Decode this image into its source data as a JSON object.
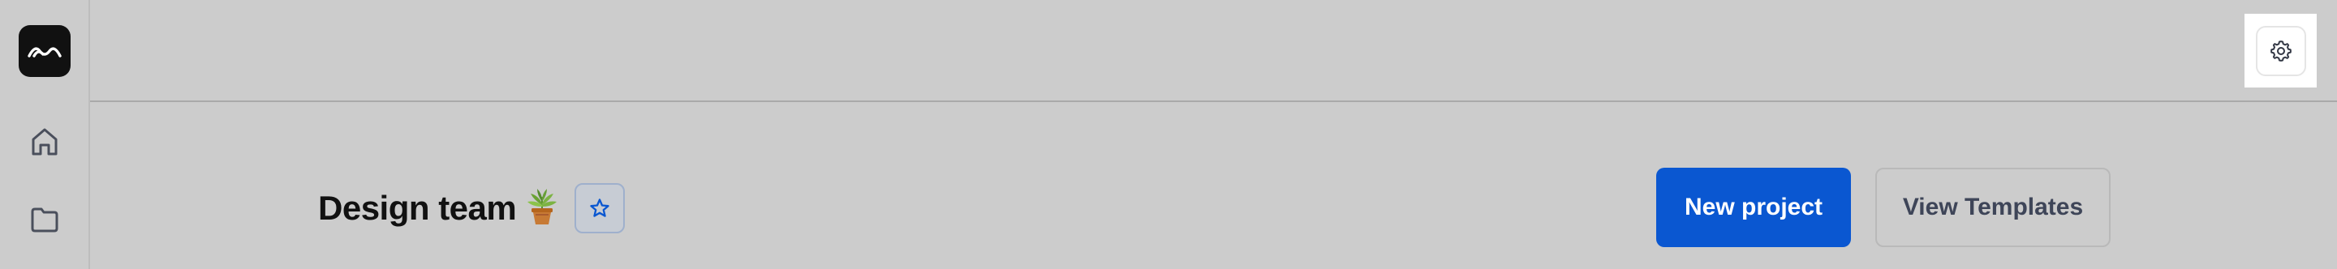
{
  "sidebar": {
    "logo_icon": "wave-logo-icon",
    "items": [
      {
        "icon": "home-icon"
      },
      {
        "icon": "folder-icon"
      }
    ]
  },
  "topbar": {
    "settings_icon": "gear-icon"
  },
  "header": {
    "title": "Design team",
    "emoji": "potted-plant-emoji",
    "favorite_icon": "star-icon"
  },
  "actions": {
    "new_project_label": "New project",
    "view_templates_label": "View Templates"
  },
  "colors": {
    "background": "#cccccc",
    "primary_button": "#0a57d1",
    "primary_button_text": "#ffffff",
    "secondary_button_text": "#3e4558",
    "star_accent": "#0a57d1"
  }
}
